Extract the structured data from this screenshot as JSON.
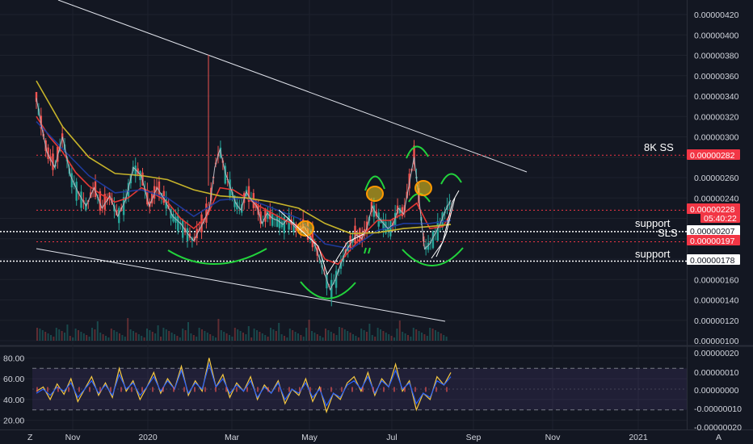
{
  "chart_data": [
    {
      "type": "line",
      "pane": "price",
      "y_ticks": [
        "0.00000420",
        "0.00000400",
        "0.00000380",
        "0.00000360",
        "0.00000340",
        "0.00000320",
        "0.00000300",
        "0.00000260",
        "0.00000240",
        "0.00000160",
        "0.00000140",
        "0.00000120",
        "0.00000100"
      ],
      "x_ticks": [
        "Nov",
        "2020",
        "Mar",
        "May",
        "Jul",
        "Sep",
        "Nov",
        "2021"
      ],
      "ylim": [
        1e-06,
        4.2e-06
      ],
      "series": [
        {
          "values": [
            [
              0,
              3.38e-06
            ],
            [
              2,
              3.1e-06
            ],
            [
              4,
              2.85e-06
            ],
            [
              7,
              2.7e-06
            ],
            [
              10,
              3e-06
            ],
            [
              13,
              2.62e-06
            ],
            [
              16,
              2.45e-06
            ],
            [
              19,
              2.32e-06
            ],
            [
              22,
              2.5e-06
            ],
            [
              25,
              2.3e-06
            ],
            [
              28,
              2.42e-06
            ],
            [
              31,
              2.22e-06
            ],
            [
              34,
              2.38e-06
            ],
            [
              37,
              2.7e-06
            ],
            [
              40,
              2.62e-06
            ],
            [
              43,
              2.32e-06
            ],
            [
              46,
              2.5e-06
            ],
            [
              49,
              2.38e-06
            ],
            [
              52,
              2.22e-06
            ],
            [
              55,
              2.15e-06
            ],
            [
              58,
              2.04e-06
            ],
            [
              60,
              1.98e-06
            ],
            [
              62,
              2.08e-06
            ],
            [
              64,
              2.18e-06
            ],
            [
              66,
              2.3e-06
            ],
            [
              68,
              2.7e-06
            ],
            [
              70,
              2.88e-06
            ],
            [
              72,
              2.65e-06
            ],
            [
              74,
              2.5e-06
            ],
            [
              76,
              2.35e-06
            ],
            [
              78,
              2.28e-06
            ],
            [
              80,
              2.46e-06
            ],
            [
              82,
              2.38e-06
            ],
            [
              84,
              2.32e-06
            ],
            [
              86,
              2.15e-06
            ],
            [
              88,
              2.25e-06
            ],
            [
              90,
              2.2e-06
            ],
            [
              92,
              2.18e-06
            ],
            [
              94,
              2.14e-06
            ],
            [
              96,
              2.2e-06
            ],
            [
              98,
              2.13e-06
            ],
            [
              100,
              2.08e-06
            ],
            [
              102,
              2.12e-06
            ],
            [
              104,
              2.04e-06
            ],
            [
              106,
              1.95e-06
            ],
            [
              108,
              1.8e-06
            ],
            [
              110,
              1.65e-06
            ],
            [
              112,
              1.5e-06
            ],
            [
              114,
              1.6e-06
            ],
            [
              116,
              1.75e-06
            ],
            [
              118,
              1.88e-06
            ],
            [
              120,
              1.96e-06
            ],
            [
              122,
              2.04e-06
            ],
            [
              124,
              2e-06
            ],
            [
              126,
              2.1e-06
            ],
            [
              128,
              2.32e-06
            ],
            [
              130,
              2.22e-06
            ],
            [
              132,
              2.16e-06
            ],
            [
              134,
              2.1e-06
            ],
            [
              136,
              2.14e-06
            ],
            [
              138,
              2.3e-06
            ],
            [
              140,
              2.24e-06
            ],
            [
              142,
              2.52e-06
            ],
            [
              144,
              2.8e-06
            ],
            [
              146,
              2.36e-06
            ],
            [
              148,
              1.9e-06
            ],
            [
              150,
              1.95e-06
            ],
            [
              152,
              2.05e-06
            ],
            [
              154,
              2.15e-06
            ],
            [
              156,
              2.28e-06
            ],
            [
              158,
              2.38e-06
            ]
          ]
        },
        {
          "name": "MA fast",
          "values": [
            [
              0,
              3.2e-06
            ],
            [
              5,
              3e-06
            ],
            [
              10,
              2.85e-06
            ],
            [
              15,
              2.65e-06
            ],
            [
              20,
              2.52e-06
            ],
            [
              25,
              2.43e-06
            ],
            [
              30,
              2.36e-06
            ],
            [
              35,
              2.4e-06
            ],
            [
              40,
              2.5e-06
            ],
            [
              45,
              2.44e-06
            ],
            [
              50,
              2.36e-06
            ],
            [
              55,
              2.2e-06
            ],
            [
              60,
              2.1e-06
            ],
            [
              65,
              2.22e-06
            ],
            [
              70,
              2.5e-06
            ],
            [
              75,
              2.48e-06
            ],
            [
              80,
              2.4e-06
            ],
            [
              85,
              2.32e-06
            ],
            [
              90,
              2.25e-06
            ],
            [
              95,
              2.18e-06
            ],
            [
              100,
              2.12e-06
            ],
            [
              105,
              2.02e-06
            ],
            [
              110,
              1.8e-06
            ],
            [
              115,
              1.75e-06
            ],
            [
              120,
              1.9e-06
            ],
            [
              125,
              2.05e-06
            ],
            [
              130,
              2.18e-06
            ],
            [
              135,
              2.18e-06
            ],
            [
              140,
              2.25e-06
            ],
            [
              145,
              2.35e-06
            ],
            [
              150,
              2.1e-06
            ],
            [
              155,
              2.12e-06
            ],
            [
              158,
              2.25e-06
            ]
          ]
        },
        {
          "name": "MA mid",
          "values": [
            [
              0,
              3.15e-06
            ],
            [
              10,
              2.88e-06
            ],
            [
              20,
              2.62e-06
            ],
            [
              30,
              2.45e-06
            ],
            [
              40,
              2.48e-06
            ],
            [
              50,
              2.4e-06
            ],
            [
              60,
              2.22e-06
            ],
            [
              70,
              2.38e-06
            ],
            [
              80,
              2.4e-06
            ],
            [
              90,
              2.3e-06
            ],
            [
              100,
              2.2e-06
            ],
            [
              110,
              1.95e-06
            ],
            [
              120,
              1.9e-06
            ],
            [
              130,
              2.08e-06
            ],
            [
              140,
              2.15e-06
            ],
            [
              150,
              2.15e-06
            ],
            [
              158,
              2.18e-06
            ]
          ]
        },
        {
          "name": "MA slow",
          "values": [
            [
              0,
              3.55e-06
            ],
            [
              10,
              3.1e-06
            ],
            [
              20,
              2.8e-06
            ],
            [
              30,
              2.64e-06
            ],
            [
              40,
              2.62e-06
            ],
            [
              50,
              2.58e-06
            ],
            [
              60,
              2.48e-06
            ],
            [
              70,
              2.42e-06
            ],
            [
              80,
              2.4e-06
            ],
            [
              90,
              2.36e-06
            ],
            [
              100,
              2.3e-06
            ],
            [
              110,
              2.15e-06
            ],
            [
              120,
              2.05e-06
            ],
            [
              130,
              2.06e-06
            ],
            [
              140,
              2.1e-06
            ],
            [
              150,
              2.12e-06
            ],
            [
              158,
              2.14e-06
            ]
          ]
        }
      ],
      "price_labels": [
        {
          "value": "0.00000282",
          "style": "red"
        },
        {
          "value": "0.00000228",
          "style": "red"
        },
        {
          "value": "05:40:22",
          "style": "red"
        },
        {
          "value": "0.00000207",
          "style": "white"
        },
        {
          "value": "0.00000197",
          "style": "red"
        },
        {
          "value": "0.00000178",
          "style": "white"
        }
      ],
      "annotations": [
        {
          "text": "8K SS",
          "level": 2.82e-06
        },
        {
          "text": "support",
          "level": 2.07e-06
        },
        {
          "text": "SLS",
          "level": 1.97e-06
        },
        {
          "text": "support",
          "level": 1.78e-06
        }
      ]
    },
    {
      "type": "line",
      "pane": "oscillator",
      "left_ticks": [
        "80.00",
        "60.00",
        "40.00",
        "20.00"
      ],
      "right_ticks": [
        "0.00000020",
        "0.00000010",
        "0.00000000",
        "-0.00000010",
        "-0.00000020"
      ],
      "ylim": [
        15,
        85
      ],
      "bands": [
        70,
        30
      ],
      "series": [
        {
          "values": [
            48,
            52,
            40,
            55,
            45,
            60,
            38,
            50,
            62,
            44,
            56,
            42,
            70,
            48,
            58,
            40,
            52,
            66,
            46,
            60,
            50,
            72,
            44,
            58,
            48,
            80,
            52,
            64,
            42,
            56,
            48,
            62,
            40,
            54,
            46,
            58,
            36,
            50,
            44,
            60,
            38,
            52,
            28,
            46,
            40,
            56,
            62,
            48,
            66,
            44,
            60,
            52,
            74,
            48,
            58,
            30,
            46,
            40,
            62,
            54,
            66
          ]
        },
        {
          "values": [
            46,
            50,
            44,
            52,
            48,
            56,
            42,
            50,
            58,
            46,
            54,
            44,
            64,
            50,
            56,
            44,
            52,
            62,
            48,
            58,
            50,
            68,
            46,
            56,
            50,
            74,
            52,
            60,
            46,
            54,
            48,
            58,
            42,
            52,
            46,
            56,
            40,
            50,
            46,
            56,
            42,
            50,
            34,
            46,
            42,
            54,
            58,
            50,
            62,
            46,
            58,
            52,
            68,
            50,
            56,
            36,
            46,
            42,
            58,
            54,
            62
          ]
        }
      ]
    }
  ],
  "icons": {
    "tradingview_logo": "Z",
    "auto_scale": "A"
  }
}
